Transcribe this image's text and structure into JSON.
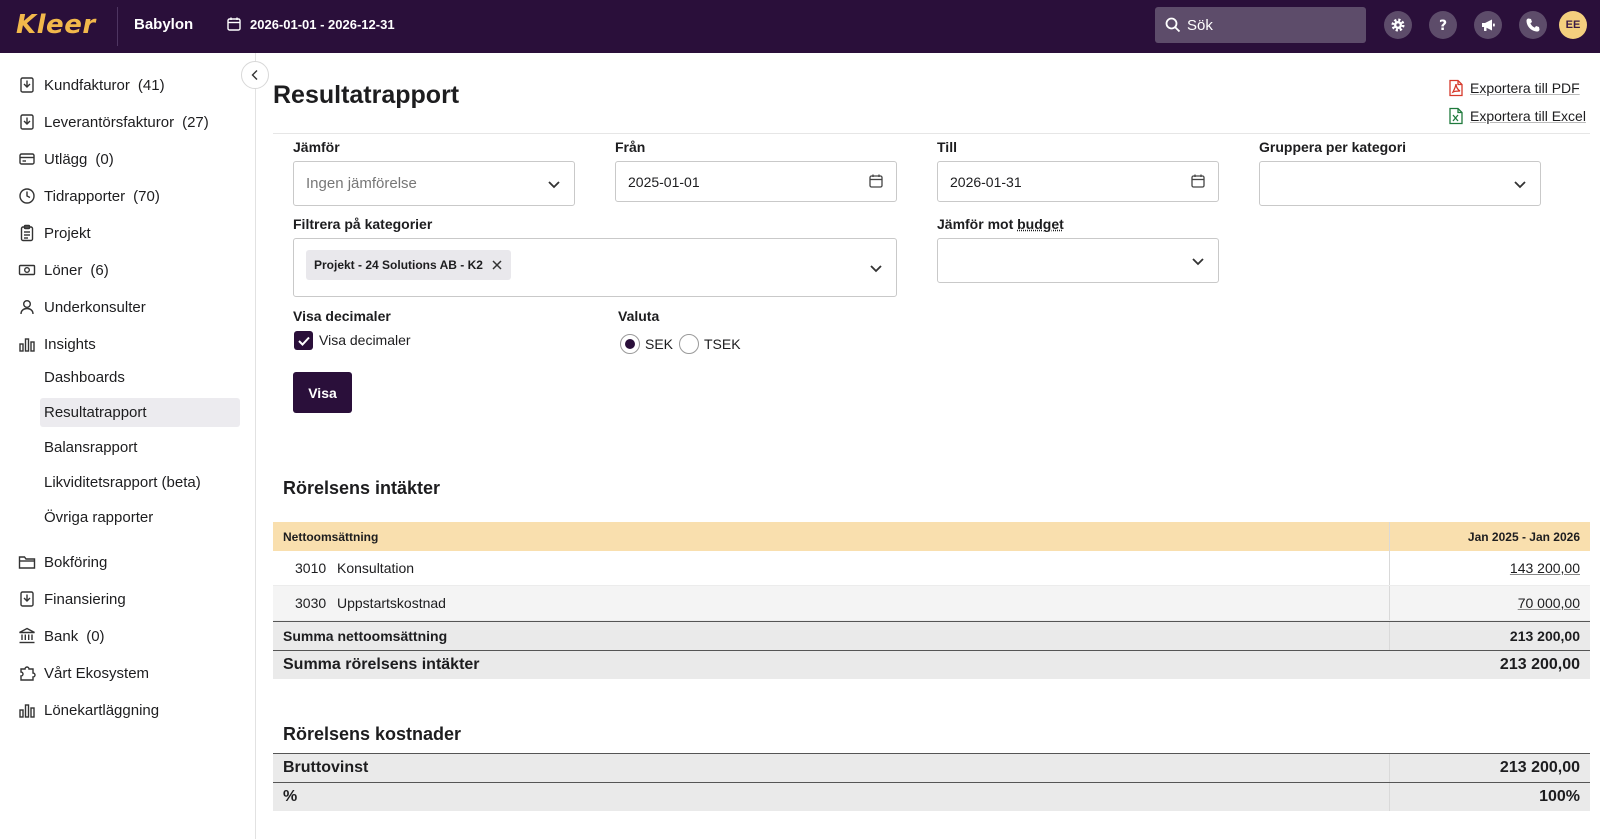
{
  "topbar": {
    "logo": "Kleer",
    "company": "Babylon",
    "period": "2026-01-01 - 2026-12-31",
    "search_placeholder": "Sök",
    "avatar": "EE"
  },
  "sidebar": {
    "items": [
      {
        "label": "Kundfakturor",
        "count": "(41)"
      },
      {
        "label": "Leverantörsfakturor",
        "count": "(27)"
      },
      {
        "label": "Utlägg",
        "count": "(0)"
      },
      {
        "label": "Tidrapporter",
        "count": "(70)"
      },
      {
        "label": "Projekt",
        "count": ""
      },
      {
        "label": "Löner",
        "count": "(6)"
      },
      {
        "label": "Underkonsulter",
        "count": ""
      },
      {
        "label": "Insights",
        "count": ""
      },
      {
        "label": "Bokföring",
        "count": ""
      },
      {
        "label": "Finansiering",
        "count": ""
      },
      {
        "label": "Bank",
        "count": "(0)"
      },
      {
        "label": "Vårt Ekosystem",
        "count": ""
      },
      {
        "label": "Lönekartläggning",
        "count": ""
      }
    ],
    "sub_items": [
      "Dashboards",
      "Resultatrapport",
      "Balansrapport",
      "Likviditetsrapport (beta)",
      "Övriga rapporter"
    ]
  },
  "page": {
    "title": "Resultatrapport",
    "export_pdf": "Exportera till PDF",
    "export_excel": "Exportera till Excel"
  },
  "form": {
    "compare_label": "Jämför",
    "compare_placeholder": "Ingen jämförelse",
    "from_label": "Från",
    "from_value": "2025-01-01",
    "to_label": "Till",
    "to_value": "2026-01-31",
    "group_label": "Gruppera per kategori",
    "filter_label": "Filtrera på kategorier",
    "filter_chip": "Projekt - 24 Solutions AB - K2",
    "budget_label_prefix": "Jämför mot",
    "budget_label_link": "budget",
    "decimals_label": "Visa decimaler",
    "decimals_checkbox_label": "Visa decimaler",
    "currency_label": "Valuta",
    "currency_options": [
      "SEK",
      "TSEK"
    ],
    "currency_selected": "SEK",
    "submit": "Visa"
  },
  "report": {
    "income_title": "Rörelsens intäkter",
    "group_header": "Nettoomsättning",
    "period_header": "Jan 2025 - Jan 2026",
    "rows": [
      {
        "account": "3010",
        "name": "Konsultation",
        "value": "143 200,00"
      },
      {
        "account": "3030",
        "name": "Uppstartskostnad",
        "value": "70 000,00"
      }
    ],
    "sum_net_label": "Summa nettoomsättning",
    "sum_net_value": "213 200,00",
    "sum_income_label": "Summa rörelsens intäkter",
    "sum_income_value": "213 200,00",
    "costs_title": "Rörelsens kostnader",
    "gross_label": "Bruttovinst",
    "gross_value": "213 200,00",
    "pct_label": "%",
    "pct_value": "100%"
  },
  "colors": {
    "topbar_bg": "#2a0f3a",
    "accent_gold": "#f2b84b",
    "table_header_bg": "#f9dfae",
    "button_bg": "#2a0f3a"
  }
}
